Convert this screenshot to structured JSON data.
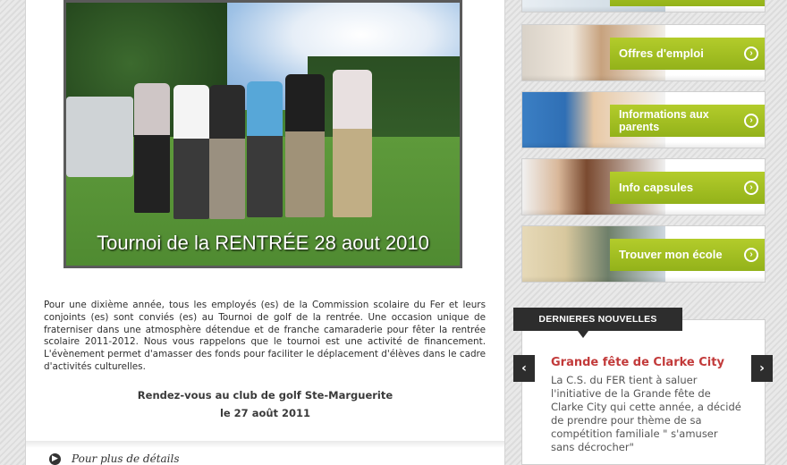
{
  "photo": {
    "caption": "Tournoi de la RENTRÉE 28 aout 2010"
  },
  "article": {
    "text": "Pour une dixième année, tous les employés (es) de la Commission scolaire du Fer et leurs conjoints (es) sont conviés (es) au Tournoi de golf de la rentrée. Une occasion unique de fraterniser dans une atmosphère détendue et de franche camaraderie pour fêter la rentrée scolaire 2011-2012. Nous vous rappelons que le tournoi est une activité de financement. L'évènement permet d'amasser des fonds pour faciliter le déplacement d'élèves dans le cadre d'activités culturelles.",
    "rdv_line1": "Rendez-vous au club de golf Ste-Marguerite",
    "rdv_line2": "le 27 août 2011"
  },
  "details": {
    "label": "Pour plus de détails",
    "icon": "arrow-right-circle-icon"
  },
  "sidebar": {
    "banners": [
      {
        "label": ""
      },
      {
        "label": "Offres d'emploi"
      },
      {
        "label": "Informations aux parents"
      },
      {
        "label": "Info capsules"
      },
      {
        "label": "Trouver mon école"
      }
    ]
  },
  "news": {
    "header": "DERNIERES NOUVELLES",
    "prev": "‹",
    "next": "›",
    "title": "Grande fête de Clarke City",
    "body": "La C.S. du FER tient à saluer l'initiative de la Grande fête de Clarke City qui cette année, a décidé de prendre pour thème de sa compétition familiale \" s'amuser sans décrocher\""
  },
  "colors": {
    "accent_green": "#9fbd21",
    "news_title": "#c23a3a",
    "dark": "#2d2d2d"
  }
}
